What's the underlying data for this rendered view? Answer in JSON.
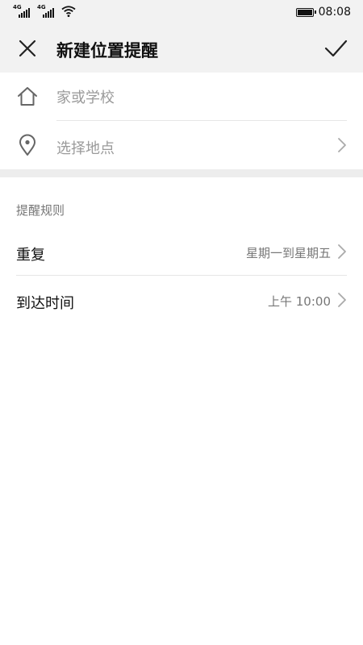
{
  "status_bar": {
    "signal_1_label": "4G",
    "signal_2_label": "4G",
    "time": "08:08",
    "icons": [
      "signal-icon",
      "signal-icon",
      "wifi-icon",
      "battery-icon"
    ]
  },
  "header": {
    "title": "新建位置提醒",
    "close_icon": "close-icon",
    "confirm_icon": "check-icon"
  },
  "location": {
    "name_placeholder": "家或学校",
    "name_icon": "home-icon",
    "place_label": "选择地点",
    "place_icon": "location-pin-icon"
  },
  "rules": {
    "section_title": "提醒规则",
    "items": [
      {
        "label": "重复",
        "value": "星期一到星期五"
      },
      {
        "label": "到达时间",
        "value": "上午 10:00"
      }
    ]
  },
  "colors": {
    "header_bg": "#f2f2f2",
    "separator": "#ededed",
    "placeholder_text": "#9a9a9a",
    "secondary_text": "#777777",
    "primary_text": "#111111"
  }
}
